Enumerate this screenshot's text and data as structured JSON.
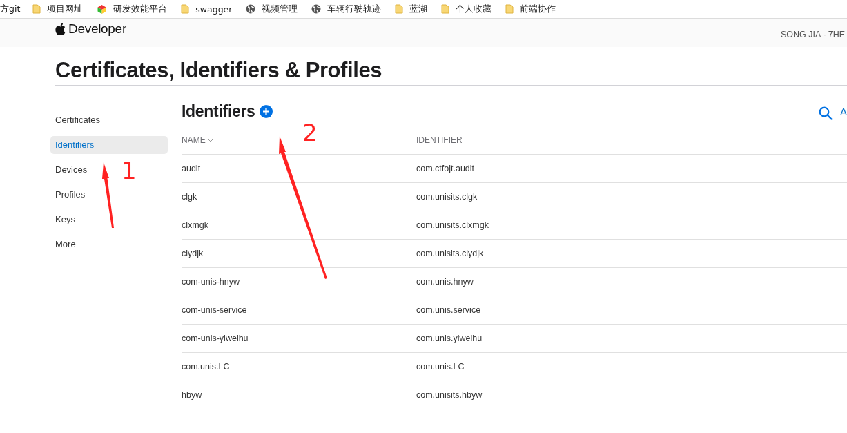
{
  "bookmarks": [
    {
      "label": "方git",
      "kind": "none"
    },
    {
      "label": "项目网址",
      "kind": "folder"
    },
    {
      "label": "研发效能平台",
      "kind": "cube"
    },
    {
      "label": "swagger",
      "kind": "folder"
    },
    {
      "label": "视频管理",
      "kind": "globe"
    },
    {
      "label": "车辆行驶轨迹",
      "kind": "globe"
    },
    {
      "label": "蓝湖",
      "kind": "folder"
    },
    {
      "label": "个人收藏",
      "kind": "folder"
    },
    {
      "label": "前端协作",
      "kind": "folder"
    }
  ],
  "header": {
    "logo": "Developer",
    "account": "SONG JIA - 7HE"
  },
  "page_title": "Certificates, Identifiers & Profiles",
  "sidebar": {
    "items": [
      {
        "label": "Certificates",
        "selected": false
      },
      {
        "label": "Identifiers",
        "selected": true
      },
      {
        "label": "Devices",
        "selected": false
      },
      {
        "label": "Profiles",
        "selected": false
      },
      {
        "label": "Keys",
        "selected": false
      },
      {
        "label": "More",
        "selected": false
      }
    ]
  },
  "section": {
    "title": "Identifiers",
    "action_label": "A"
  },
  "table": {
    "columns": [
      "NAME",
      "IDENTIFIER"
    ],
    "rows": [
      [
        "audit",
        "com.ctfojt.audit"
      ],
      [
        "clgk",
        "com.unisits.clgk"
      ],
      [
        "clxmgk",
        "com.unisits.clxmgk"
      ],
      [
        "clydjk",
        "com.unisits.clydjk"
      ],
      [
        "com-unis-hnyw",
        "com.unis.hnyw"
      ],
      [
        "com-unis-service",
        "com.unis.service"
      ],
      [
        "com-unis-yiweihu",
        "com.unis.yiweihu"
      ],
      [
        "com.unis.LC",
        "com.unis.LC"
      ],
      [
        "hbyw",
        "com.unisits.hbyw"
      ]
    ]
  },
  "annotations": [
    {
      "label": "1"
    },
    {
      "label": "2"
    }
  ]
}
